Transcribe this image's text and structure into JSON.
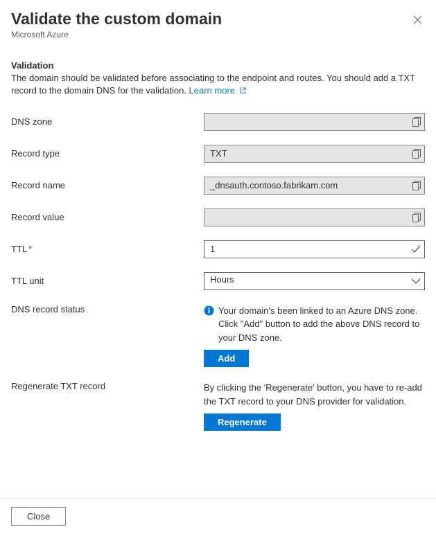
{
  "header": {
    "title": "Validate the custom domain",
    "subtitle": "Microsoft Azure"
  },
  "section": {
    "heading": "Validation",
    "body": "The domain should be validated before associating to the endpoint and routes. You should add a TXT record to the domain DNS for the validation. ",
    "learn_more": "Learn more"
  },
  "fields": {
    "dns_zone": {
      "label": "DNS zone",
      "value": ""
    },
    "record_type": {
      "label": "Record type",
      "value": "TXT"
    },
    "record_name": {
      "label": "Record name",
      "value": "_dnsauth.contoso.fabrikam.com"
    },
    "record_value": {
      "label": "Record value",
      "value": ""
    },
    "ttl": {
      "label": "TTL",
      "value": "1",
      "required": "*"
    },
    "ttl_unit": {
      "label": "TTL unit",
      "value": "Hours"
    },
    "dns_status": {
      "label": "DNS record status",
      "message": "Your domain's been linked to an Azure DNS zone. Click \"Add\" button to add the above DNS record to your DNS zone.",
      "button": "Add"
    },
    "regenerate": {
      "label": "Regenerate TXT record",
      "message": "By clicking the 'Regenerate' button, you have to re-add the TXT record to your DNS provider for validation.",
      "button": "Regenerate"
    }
  },
  "footer": {
    "close": "Close"
  }
}
